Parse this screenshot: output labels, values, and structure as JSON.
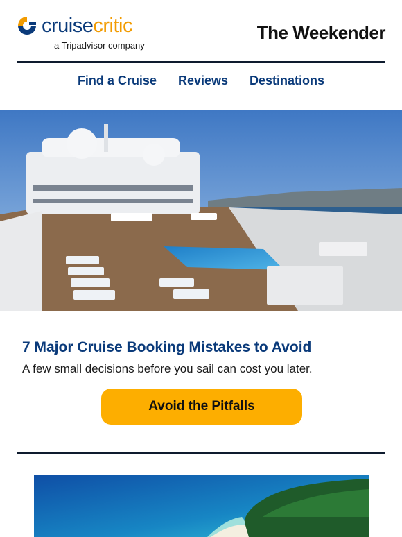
{
  "header": {
    "logo_text_1": "cruise",
    "logo_text_2": "critic",
    "logo_subtitle": "a Tripadvisor company",
    "newsletter_title": "The Weekender"
  },
  "nav": {
    "items": [
      {
        "label": "Find a Cruise"
      },
      {
        "label": "Reviews"
      },
      {
        "label": "Destinations"
      }
    ]
  },
  "article": {
    "headline": "7 Major Cruise Booking Mistakes to Avoid",
    "subheadline": "A few small decisions before you sail can cost you later.",
    "cta_label": "Avoid the Pitfalls"
  },
  "colors": {
    "brand_navy": "#0a3a7a",
    "brand_orange": "#f29b00",
    "cta": "#fdae00",
    "rule": "#0e1b2e"
  }
}
